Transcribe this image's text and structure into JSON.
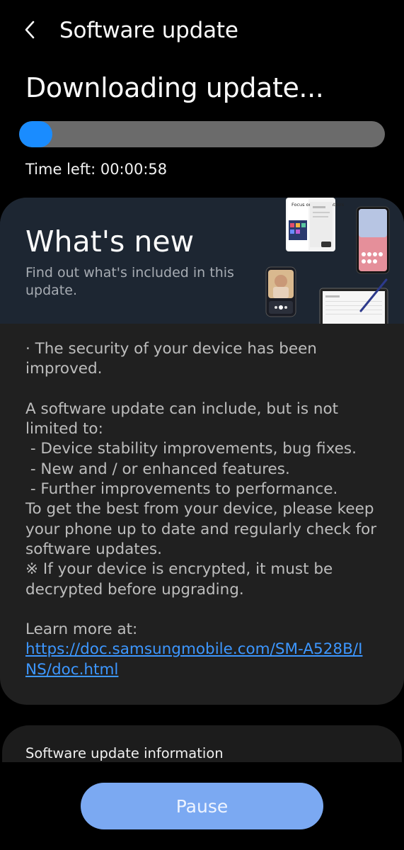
{
  "header": {
    "title": "Software update"
  },
  "status": {
    "title": "Downloading update...",
    "progress": 0.09,
    "time_left": "Time left: 00:00:58",
    "progress_color": "#1a8cff"
  },
  "whats_new": {
    "title": "What's new",
    "subtitle": "Find out what's included in this update.",
    "hero_phone_text": "Focus on what matters",
    "paragraphs": [
      "· The security of your device has been improved.",
      "",
      "A software update can include, but is not limited to:",
      " - Device stability improvements, bug fixes.",
      " - New and / or enhanced features.",
      " - Further improvements to performance.",
      "To get the best from your device, please keep your phone up to date and regularly check for software updates.",
      "※ If your device is encrypted, it must be decrypted before upgrading.",
      "",
      "Learn more at:"
    ],
    "link_text": "https://doc.samsungmobile.com/SM-A528B/INS/doc.html"
  },
  "info_section": {
    "label": "Software update information"
  },
  "actions": {
    "pause_label": "Pause"
  }
}
